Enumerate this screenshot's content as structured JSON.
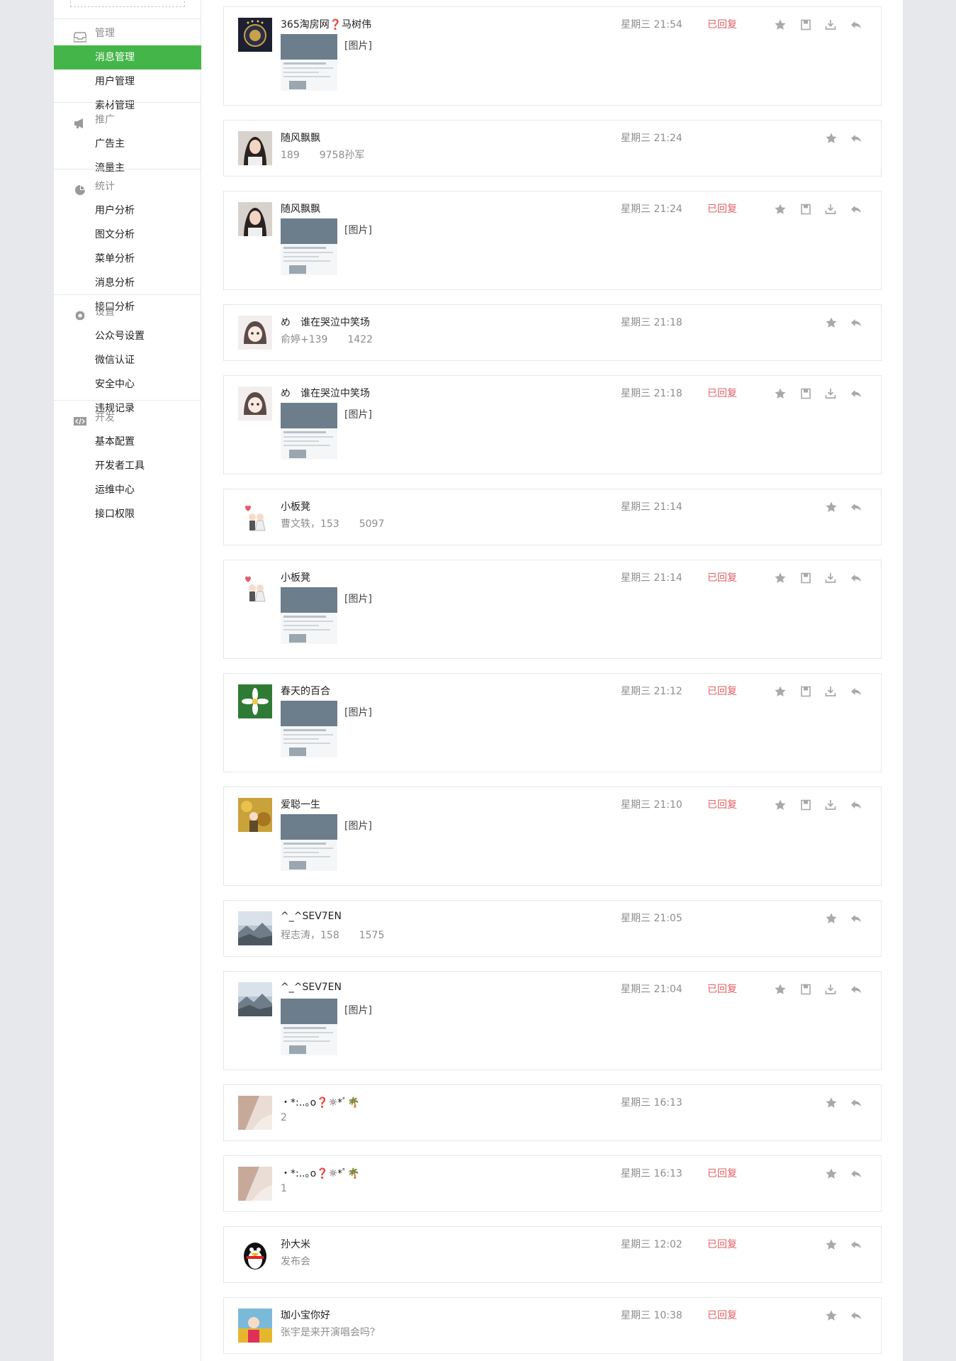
{
  "sidebar": {
    "groups": [
      {
        "title": "管理",
        "icon": "inbox-icon",
        "items": [
          {
            "label": "消息管理",
            "active": true
          },
          {
            "label": "用户管理"
          },
          {
            "label": "素材管理"
          }
        ]
      },
      {
        "title": "推广",
        "icon": "megaphone-icon",
        "items": [
          {
            "label": "广告主"
          },
          {
            "label": "流量主"
          }
        ]
      },
      {
        "title": "统计",
        "icon": "pie-chart-icon",
        "items": [
          {
            "label": "用户分析"
          },
          {
            "label": "图文分析"
          },
          {
            "label": "菜单分析"
          },
          {
            "label": "消息分析"
          },
          {
            "label": "接口分析"
          }
        ]
      },
      {
        "title": "设置",
        "icon": "gear-icon",
        "items": [
          {
            "label": "公众号设置"
          },
          {
            "label": "微信认证"
          },
          {
            "label": "安全中心"
          },
          {
            "label": "违规记录"
          }
        ]
      },
      {
        "title": "开发",
        "icon": "code-icon",
        "items": [
          {
            "label": "基本配置"
          },
          {
            "label": "开发者工具"
          },
          {
            "label": "运维中心"
          },
          {
            "label": "接口权限"
          }
        ]
      }
    ]
  },
  "messages": [
    {
      "name": "365淘房网❓马树伟",
      "time": "星期三 21:54",
      "status": "已回复",
      "image": true,
      "tag": "[图片]",
      "avatar": "avatar-emblem"
    },
    {
      "name": "随风飘飘",
      "time": "星期三 21:24",
      "status": "",
      "image": false,
      "text": "189　　9758孙军",
      "avatar": "avatar-girl"
    },
    {
      "name": "随风飘飘",
      "time": "星期三 21:24",
      "status": "已回复",
      "image": true,
      "tag": "[图片]",
      "avatar": "avatar-girl"
    },
    {
      "name": "め　谁在哭泣中笑场",
      "time": "星期三 21:18",
      "status": "",
      "image": false,
      "text": "俞婷+139　　1422",
      "avatar": "avatar-doll"
    },
    {
      "name": "め　谁在哭泣中笑场",
      "time": "星期三 21:18",
      "status": "已回复",
      "image": true,
      "tag": "[图片]",
      "avatar": "avatar-doll"
    },
    {
      "name": "小板凳",
      "time": "星期三 21:14",
      "status": "",
      "image": false,
      "text": "曹文轶，153　　5097",
      "avatar": "avatar-couple"
    },
    {
      "name": "小板凳",
      "time": "星期三 21:14",
      "status": "已回复",
      "image": true,
      "tag": "[图片]",
      "avatar": "avatar-couple"
    },
    {
      "name": "春天的百合",
      "time": "星期三 21:12",
      "status": "已回复",
      "image": true,
      "tag": "[图片]",
      "avatar": "avatar-flower"
    },
    {
      "name": "爱聪一生",
      "time": "星期三 21:10",
      "status": "已回复",
      "image": true,
      "tag": "[图片]",
      "avatar": "avatar-autumn"
    },
    {
      "name": "^_^SEV7EN",
      "time": "星期三 21:05",
      "status": "",
      "image": false,
      "text": "程志涛，158　　1575",
      "avatar": "avatar-mountain"
    },
    {
      "name": "^_^SEV7EN",
      "time": "星期三 21:04",
      "status": "已回复",
      "image": true,
      "tag": "[图片]",
      "avatar": "avatar-mountain"
    },
    {
      "name": "・*:..｡o❓☼*ﾟ🌴",
      "time": "星期三 16:13",
      "status": "",
      "image": false,
      "text": "2",
      "avatar": "avatar-photo"
    },
    {
      "name": "・*:..｡o❓☼*ﾟ🌴",
      "time": "星期三 16:13",
      "status": "已回复",
      "image": false,
      "text": "1",
      "avatar": "avatar-photo"
    },
    {
      "name": "孙大米",
      "time": "星期三 12:02",
      "status": "已回复",
      "image": false,
      "text": "发布会",
      "avatar": "avatar-penguin"
    },
    {
      "name": "珈小宝你好",
      "time": "星期三 10:38",
      "status": "已回复",
      "image": false,
      "text": "张宇是来开演唱会吗？",
      "avatar": "avatar-kid"
    }
  ]
}
